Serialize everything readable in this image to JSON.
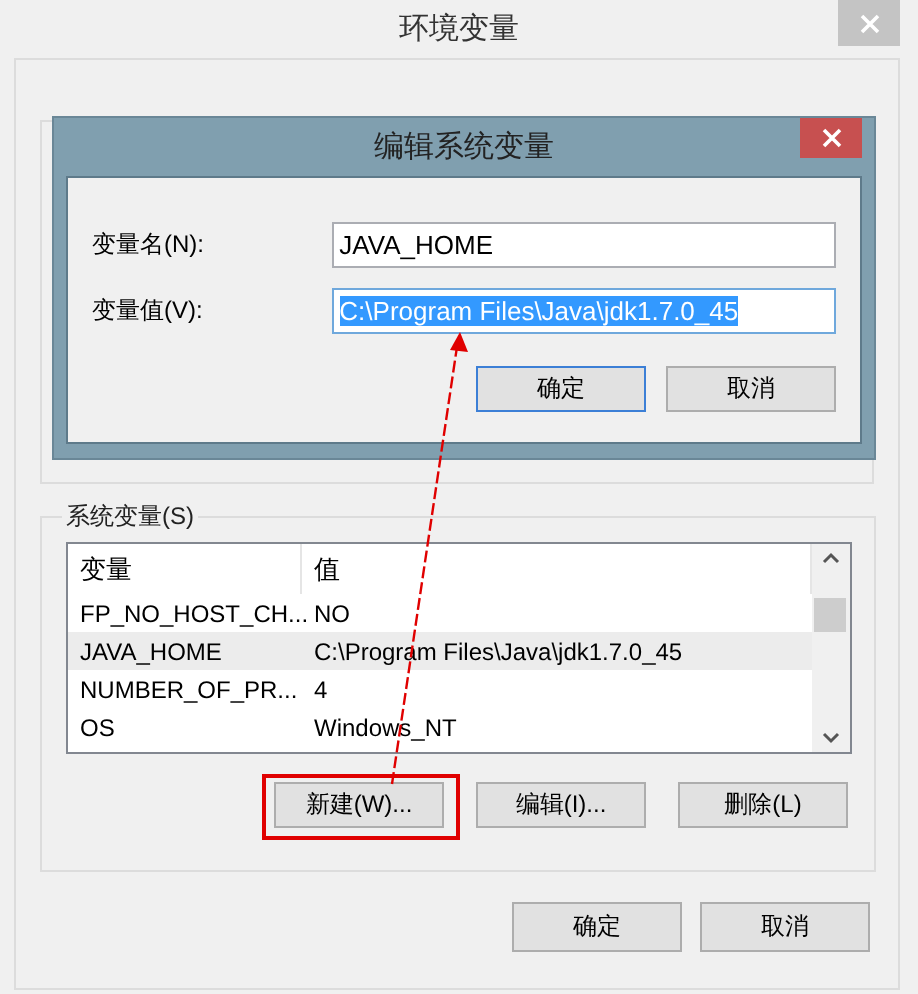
{
  "window": {
    "title": "环境变量"
  },
  "system_variables": {
    "label": "系统变量(S)",
    "columns": [
      "变量",
      "值"
    ],
    "rows": [
      {
        "name": "FP_NO_HOST_CH...",
        "value": "NO",
        "selected": false
      },
      {
        "name": "JAVA_HOME",
        "value": "C:\\Program Files\\Java\\jdk1.7.0_45",
        "selected": true
      },
      {
        "name": "NUMBER_OF_PR...",
        "value": "4",
        "selected": false
      },
      {
        "name": "OS",
        "value": "Windows_NT",
        "selected": false
      }
    ],
    "buttons": [
      {
        "label": "新建(W)...",
        "highlighted": true
      },
      {
        "label": "编辑(I)...",
        "highlighted": false
      },
      {
        "label": "删除(L)",
        "highlighted": false
      }
    ]
  },
  "buttons": [
    "确定",
    "取消"
  ],
  "dialog": {
    "title": "编辑系统变量",
    "fields": [
      {
        "label": "变量名(N):",
        "value": "JAVA_HOME",
        "selected": false
      },
      {
        "label": "变量值(V):",
        "value": "C:\\Program Files\\Java\\jdk1.7.0_45",
        "selected": true
      }
    ],
    "buttons": [
      {
        "label": "确定",
        "default": true
      },
      {
        "label": "取消",
        "default": false
      }
    ]
  }
}
